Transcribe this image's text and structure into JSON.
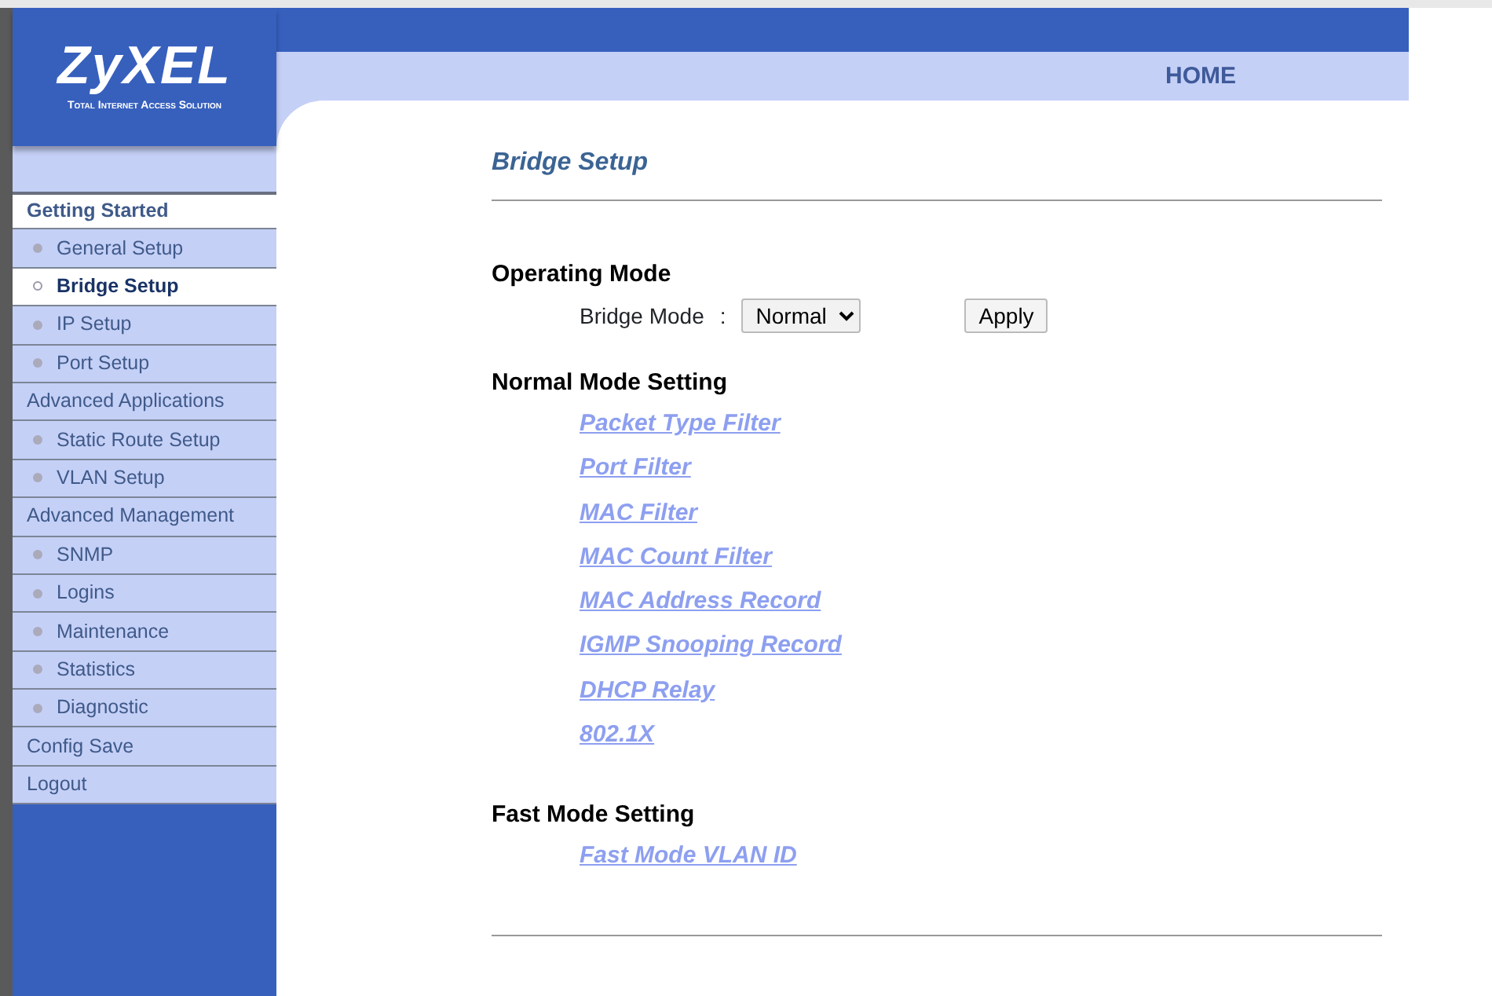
{
  "logo": {
    "brand": "ZyXEL",
    "tagline": "Total Internet Access Solution"
  },
  "header": {
    "home_link": "HOME"
  },
  "sidebar": {
    "items": [
      {
        "kind": "section",
        "label": "Getting Started",
        "selected": false,
        "expanded": true
      },
      {
        "kind": "item",
        "label": "General Setup",
        "selected": false
      },
      {
        "kind": "item",
        "label": "Bridge Setup",
        "selected": true
      },
      {
        "kind": "item",
        "label": "IP Setup",
        "selected": false
      },
      {
        "kind": "item",
        "label": "Port Setup",
        "selected": false
      },
      {
        "kind": "section",
        "label": "Advanced Applications",
        "selected": false,
        "expanded": false
      },
      {
        "kind": "item",
        "label": "Static Route Setup",
        "selected": false
      },
      {
        "kind": "item",
        "label": "VLAN Setup",
        "selected": false
      },
      {
        "kind": "section",
        "label": "Advanced Management",
        "selected": false,
        "expanded": false
      },
      {
        "kind": "item",
        "label": "SNMP",
        "selected": false
      },
      {
        "kind": "item",
        "label": "Logins",
        "selected": false
      },
      {
        "kind": "item",
        "label": "Maintenance",
        "selected": false
      },
      {
        "kind": "item",
        "label": "Statistics",
        "selected": false
      },
      {
        "kind": "item",
        "label": "Diagnostic",
        "selected": false
      },
      {
        "kind": "section",
        "label": "Config Save",
        "selected": false,
        "expanded": false
      },
      {
        "kind": "section",
        "label": "Logout",
        "selected": false,
        "expanded": false
      }
    ]
  },
  "page": {
    "title": "Bridge Setup",
    "operating_mode": {
      "heading": "Operating Mode",
      "label": "Bridge Mode",
      "separator": ":",
      "value": "Normal",
      "apply_button": "Apply"
    },
    "sections": [
      {
        "heading": "Normal Mode Setting",
        "links": [
          "Packet Type Filter",
          "Port Filter",
          "MAC Filter",
          "MAC Count Filter",
          "MAC Address Record",
          "IGMP Snooping Record",
          "DHCP Relay",
          "802.1X"
        ]
      },
      {
        "heading": "Fast Mode Setting",
        "links": [
          "Fast Mode VLAN ID"
        ]
      }
    ]
  }
}
